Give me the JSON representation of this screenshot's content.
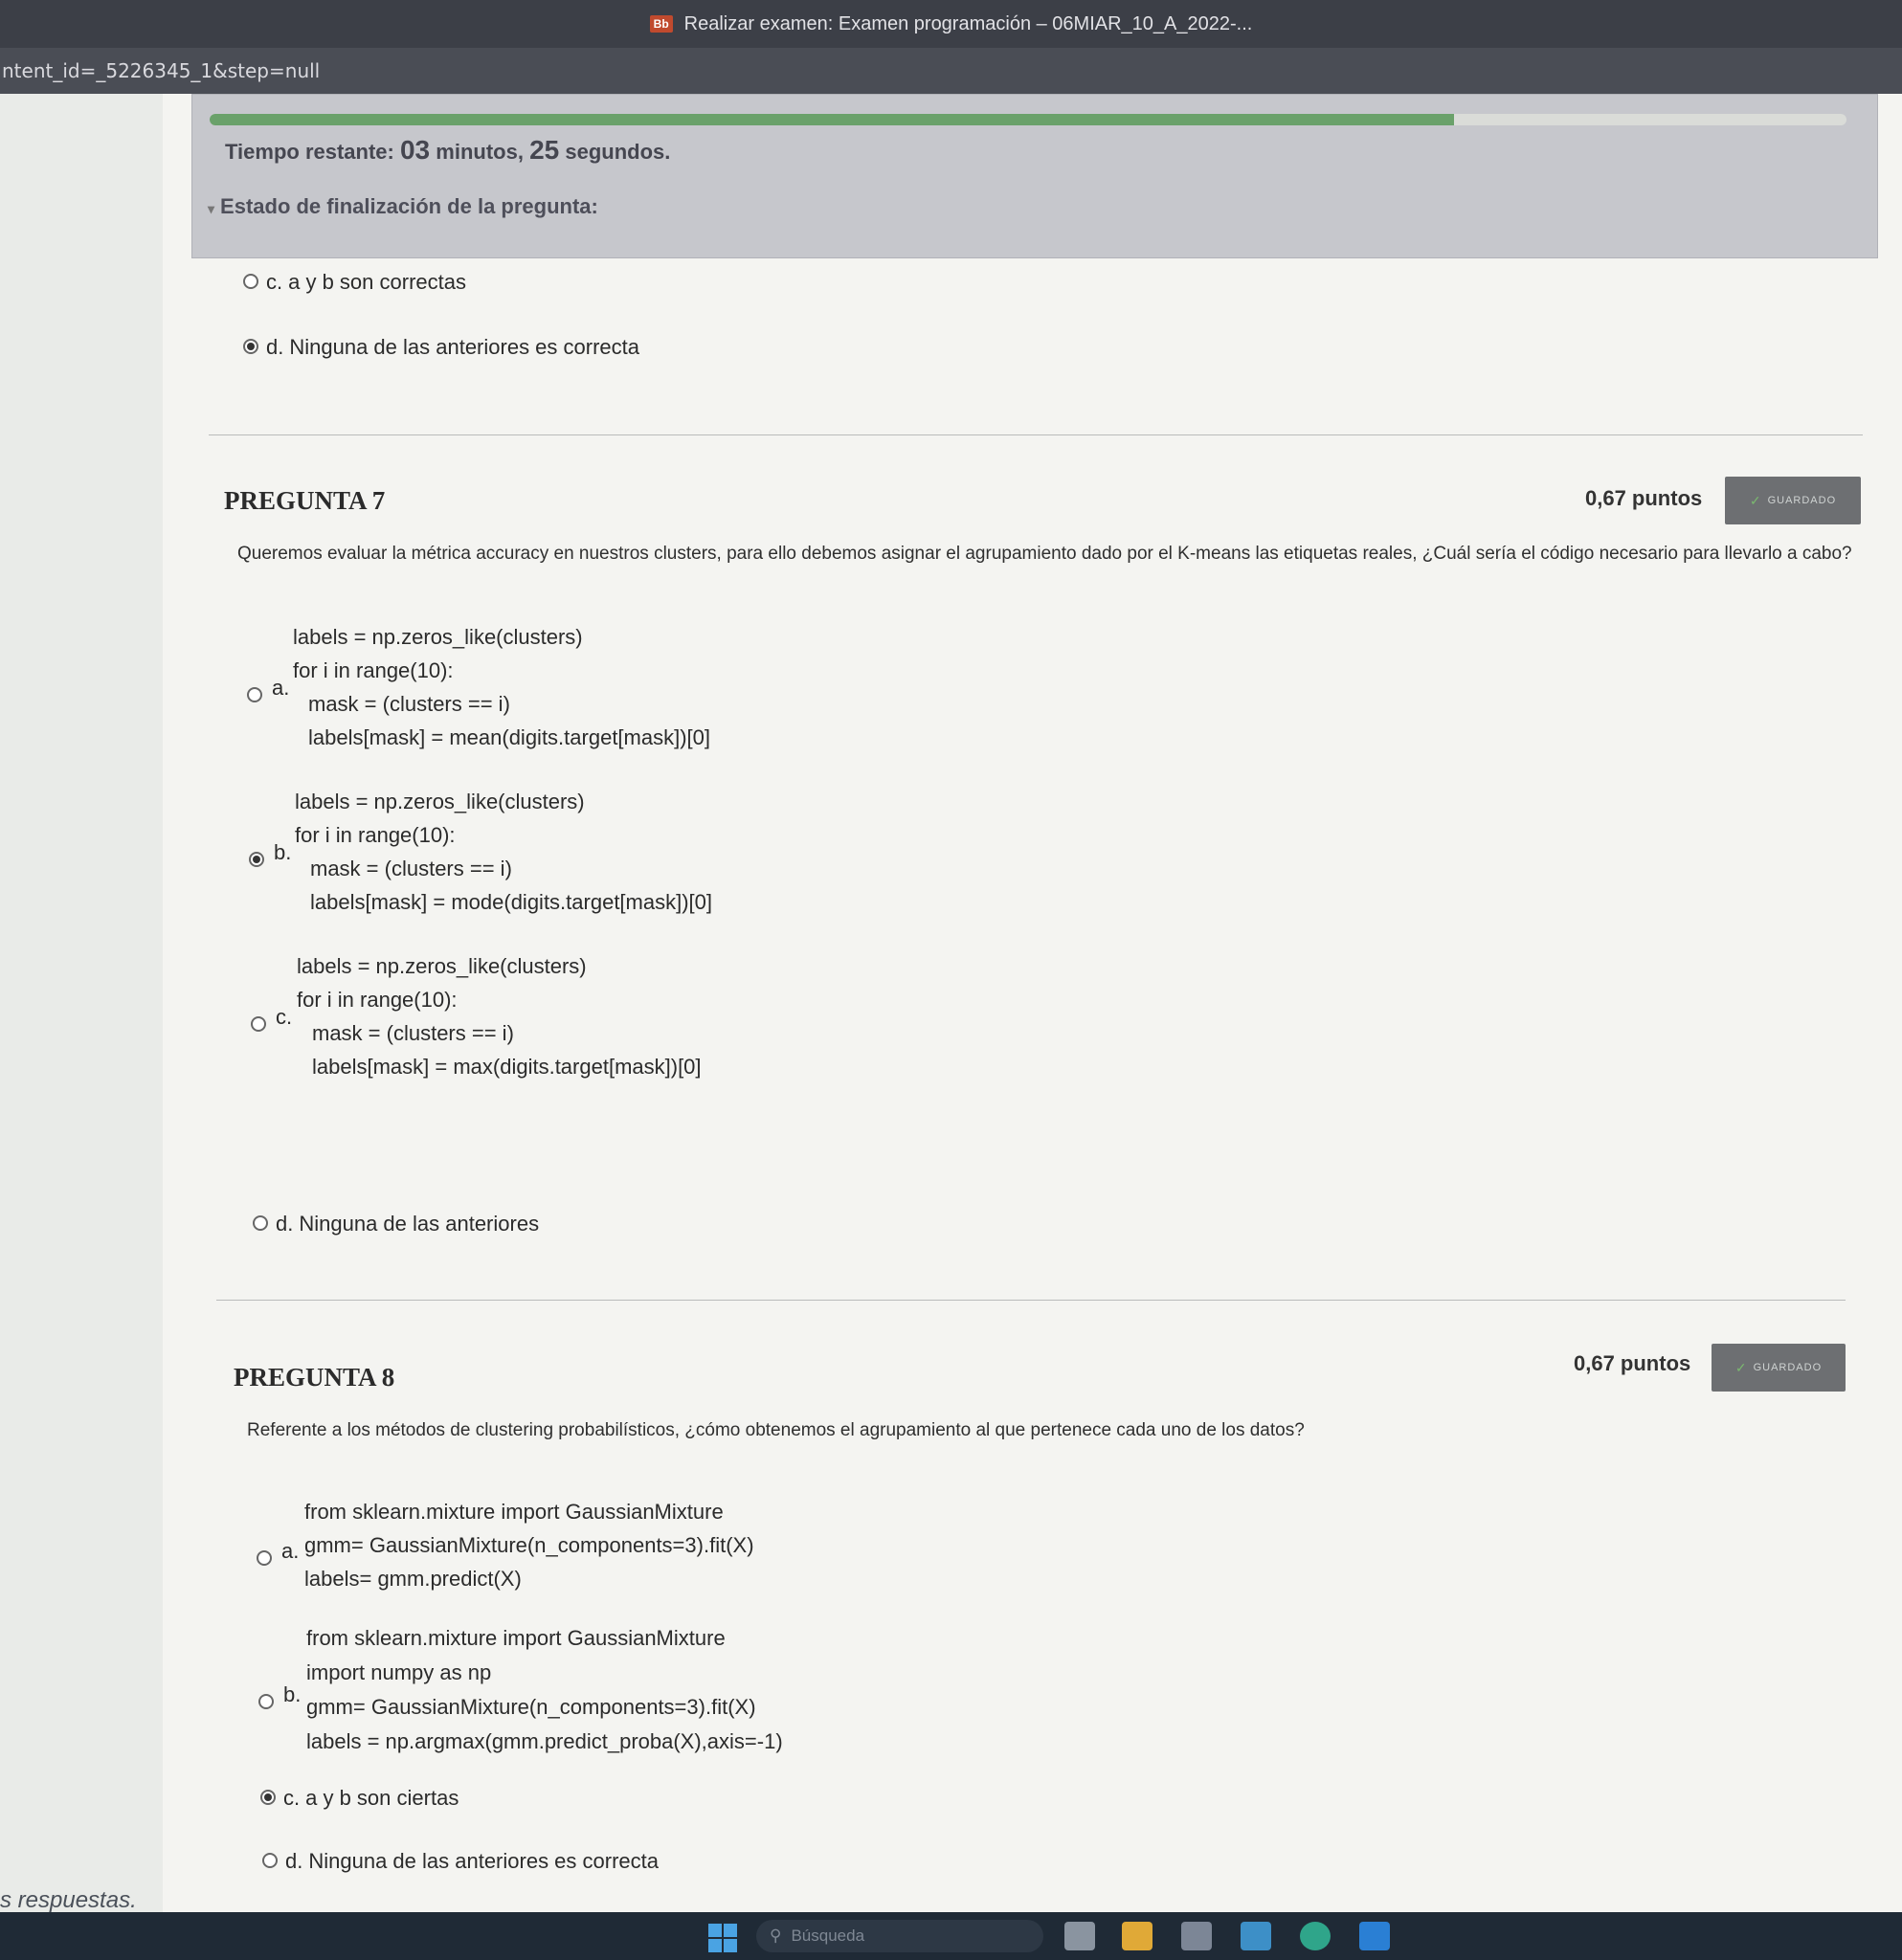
{
  "window": {
    "title": "Realizar examen: Examen programación – 06MIAR_10_A_2022-...",
    "app_icon": "Bb"
  },
  "url": "ntent_id=_5226345_1&step=null",
  "timer": {
    "label": "Tiempo restante:",
    "minutes": "03",
    "minutes_unit": "minutos,",
    "seconds": "25",
    "seconds_unit": "segundos.",
    "progress_fraction": 0.76,
    "status_label": "Estado de finalización de la pregunta:"
  },
  "prev_question_options": [
    {
      "letter": "c.",
      "text": "a y b son correctas",
      "checked": false
    },
    {
      "letter": "d.",
      "text": "Ninguna de las anteriores es correcta",
      "checked": true
    }
  ],
  "q7": {
    "title": "PREGUNTA 7",
    "points": "0,67 puntos",
    "saved": "GUARDADO",
    "text": "Queremos evaluar la métrica accuracy en nuestros clusters, para ello debemos asignar el agrupamiento dado por el K-means las etiquetas reales, ¿Cuál sería el código necesario para llevarlo a cabo?",
    "options": {
      "a": {
        "letter": "a.",
        "lines": [
          "labels = np.zeros_like(clusters)",
          "for i in range(10):",
          "mask = (clusters == i)",
          "labels[mask] = mean(digits.target[mask])[0]"
        ]
      },
      "b": {
        "letter": "b.",
        "lines": [
          "labels = np.zeros_like(clusters)",
          "for i in range(10):",
          "mask = (clusters == i)",
          "labels[mask] = mode(digits.target[mask])[0]"
        ]
      },
      "c": {
        "letter": "c.",
        "lines": [
          "labels = np.zeros_like(clusters)",
          "for i in range(10):",
          "mask = (clusters == i)",
          "labels[mask] = max(digits.target[mask])[0]"
        ]
      },
      "d": {
        "letter": "d.",
        "text": "Ninguna de las anteriores"
      }
    },
    "selected": "b"
  },
  "q8": {
    "title": "PREGUNTA 8",
    "points": "0,67 puntos",
    "saved": "GUARDADO",
    "text": "Referente a los métodos de clustering probabilísticos, ¿cómo obtenemos el agrupamiento  al que pertenece cada uno de los datos?",
    "options": {
      "a": {
        "letter": "a.",
        "lines": [
          "from sklearn.mixture import GaussianMixture",
          "gmm= GaussianMixture(n_components=3).fit(X)",
          "labels= gmm.predict(X)"
        ]
      },
      "b": {
        "letter": "b.",
        "lines": [
          "from sklearn.mixture import GaussianMixture",
          "import numpy as np",
          "gmm= GaussianMixture(n_components=3).fit(X)",
          "labels = np.argmax(gmm.predict_proba(X),axis=-1)"
        ]
      },
      "c": {
        "letter": "c.",
        "text": "a y b son ciertas"
      },
      "d": {
        "letter": "d.",
        "text": "Ninguna de las anteriores es correcta"
      }
    },
    "selected": "c"
  },
  "footer_text": "s respuestas.",
  "taskbar": {
    "search_placeholder": "Búsqueda"
  }
}
